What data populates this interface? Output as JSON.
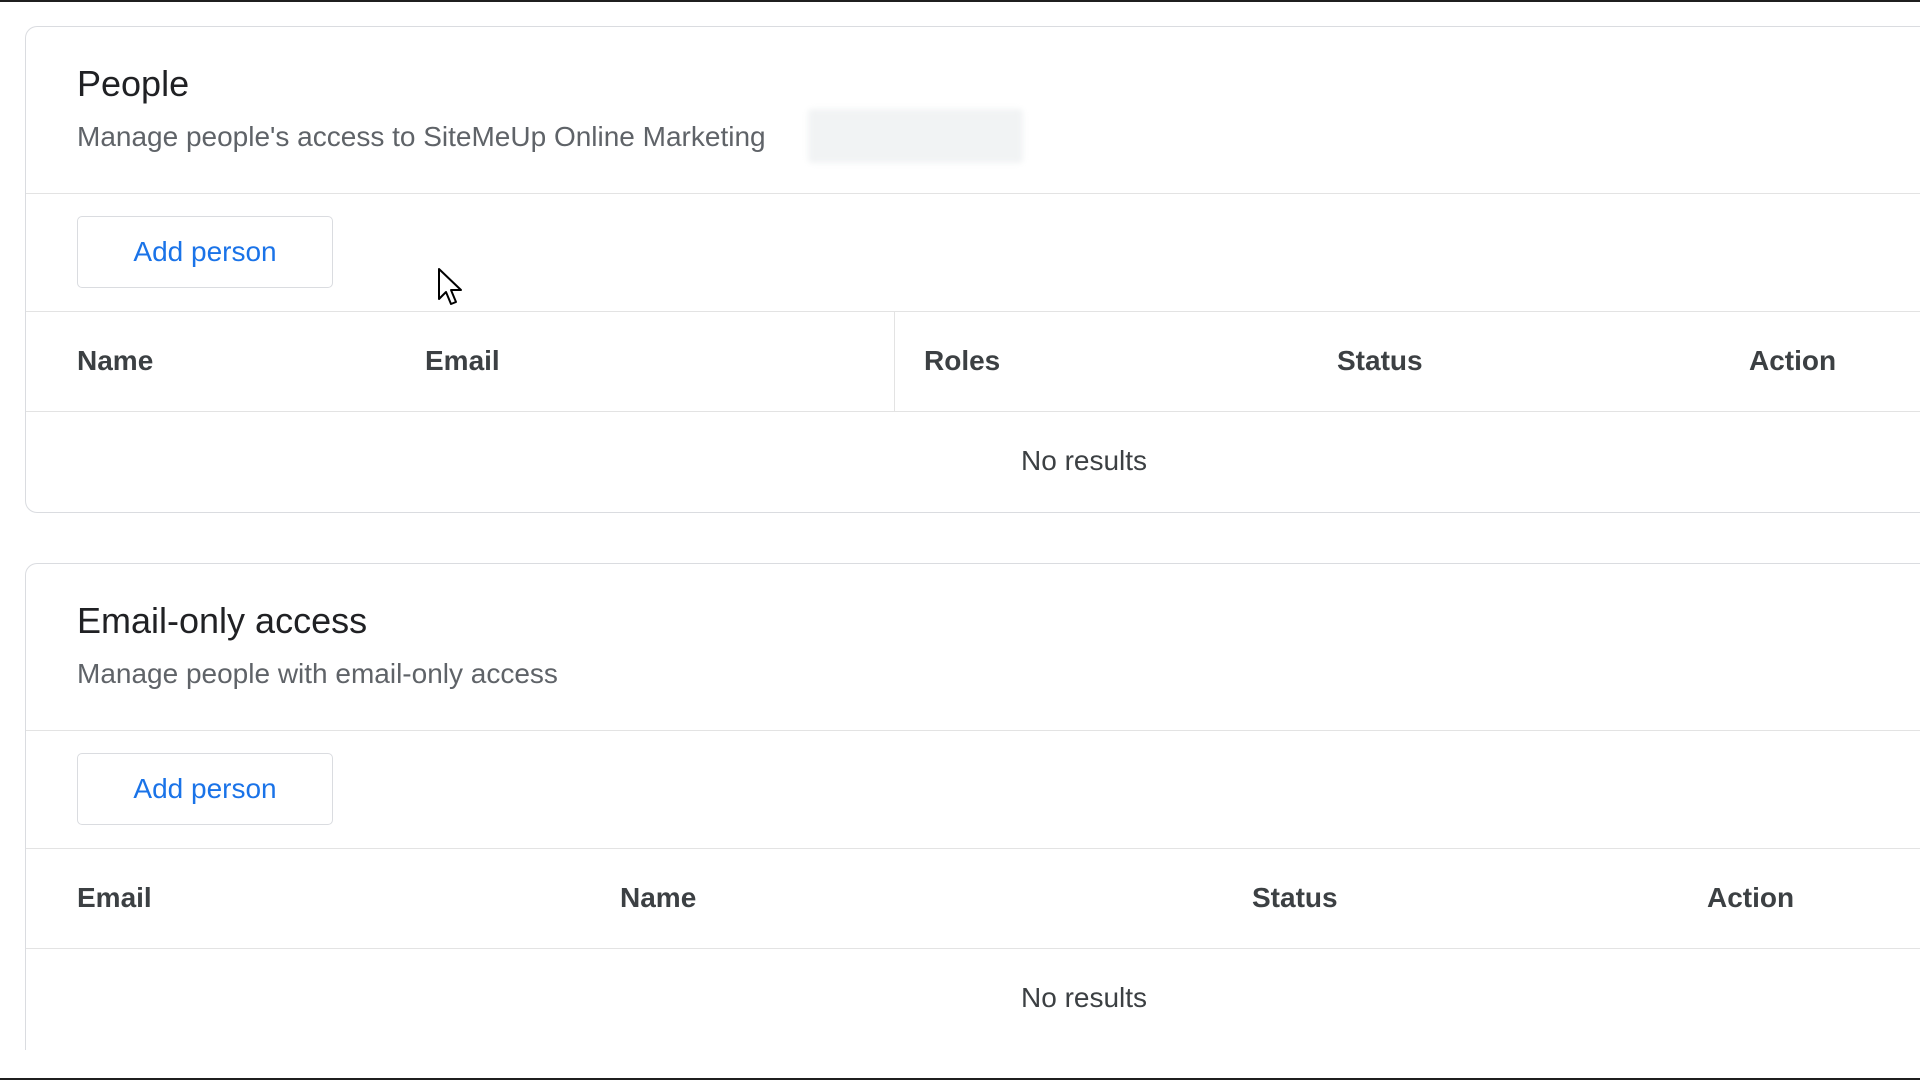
{
  "people": {
    "title": "People",
    "subtitle": "Manage people's access to SiteMeUp Online Marketing",
    "add_button": "Add person",
    "columns": [
      "Name",
      "Email",
      "Roles",
      "Status",
      "Action"
    ],
    "empty_text": "No results"
  },
  "email_only": {
    "title": "Email-only access",
    "subtitle": "Manage people with email-only access",
    "add_button": "Add person",
    "columns": [
      "Email",
      "Name",
      "Status",
      "Action"
    ],
    "empty_text": "No results"
  },
  "icons": {
    "cursor": "mouse-pointer-icon"
  },
  "colors": {
    "accent": "#1a73e8",
    "border": "#dadce0",
    "text_secondary": "#5f6368"
  }
}
